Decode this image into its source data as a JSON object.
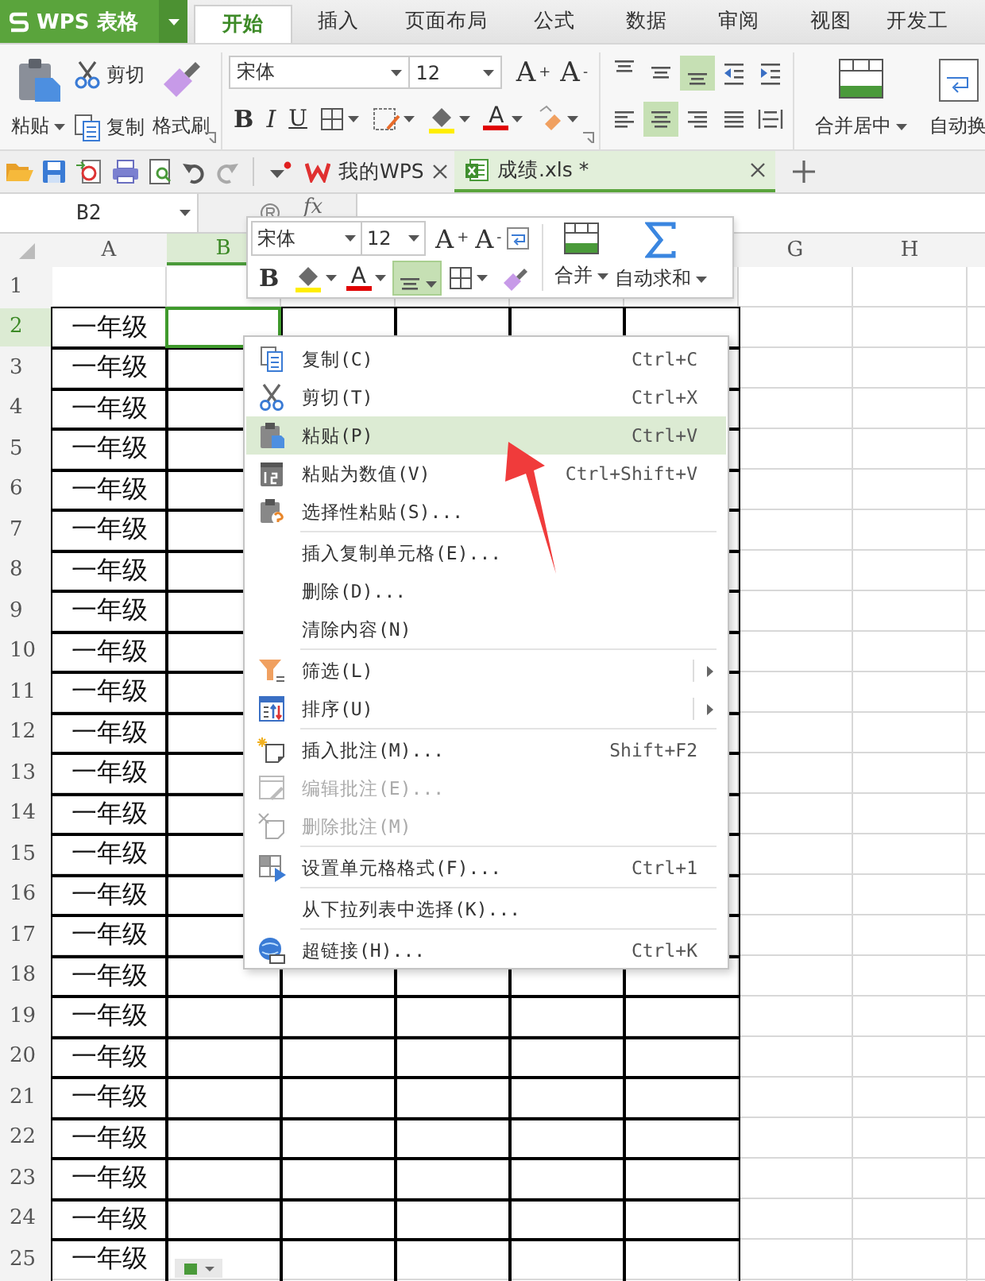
{
  "app_menu": {
    "label": "WPS 表格"
  },
  "ribbon_tabs": [
    {
      "label": "开始",
      "selected": true
    },
    {
      "label": "插入",
      "selected": false
    },
    {
      "label": "页面布局",
      "selected": false
    },
    {
      "label": "公式",
      "selected": false
    },
    {
      "label": "数据",
      "selected": false
    },
    {
      "label": "审阅",
      "selected": false
    },
    {
      "label": "视图",
      "selected": false
    },
    {
      "label": "开发工",
      "selected": false
    }
  ],
  "ribbon": {
    "clipboard": {
      "paste": "粘贴",
      "cut": "剪切",
      "copy": "复制",
      "format_painter": "格式刷"
    },
    "font": {
      "name": "宋体",
      "size": "12",
      "grow": "A$^{+}$",
      "shrink": "A$^{-}$",
      "bold": "B",
      "italic": "I",
      "underline": "U",
      "font_color": "A"
    },
    "alignment": [
      {
        "kind": "top",
        "selected": false
      },
      {
        "kind": "middle",
        "selected": false
      },
      {
        "kind": "bottom",
        "selected": true
      },
      {
        "kind": "outdent",
        "selected": false
      },
      {
        "kind": "indent",
        "selected": false
      },
      {
        "kind": "left",
        "selected": false
      },
      {
        "kind": "center",
        "selected": true
      },
      {
        "kind": "right",
        "selected": false
      },
      {
        "kind": "justify",
        "selected": false
      },
      {
        "kind": "distributed",
        "selected": false
      }
    ],
    "merge": {
      "label": "合并居中"
    },
    "wrap": {
      "label": "自动换"
    }
  },
  "doc_tabs": [
    {
      "kind": "home",
      "label": "我的WPS",
      "selected": false
    },
    {
      "kind": "sheet",
      "label": "成绩.xls *",
      "selected": true
    }
  ],
  "formula_bar": {
    "name_box": "B2",
    "fx": "fx"
  },
  "sheet": {
    "columns": [
      {
        "label": "A",
        "selected": false,
        "bordered": true
      },
      {
        "label": "B",
        "selected": true,
        "bordered": true
      },
      {
        "selected": false,
        "bordered": true
      },
      {
        "selected": false,
        "bordered": true
      },
      {
        "selected": false,
        "bordered": true
      },
      {
        "selected": false,
        "bordered": true
      },
      {
        "label": "G",
        "selected": false,
        "bordered": false
      },
      {
        "label": "H",
        "selected": false,
        "bordered": false
      }
    ],
    "rows": [
      {
        "number": "1",
        "selected": false,
        "bordered": false
      },
      {
        "number": "2",
        "selected": true,
        "bordered": true,
        "grade": "一年级"
      },
      {
        "number": "3",
        "selected": false,
        "bordered": true,
        "grade": "一年级"
      },
      {
        "number": "4",
        "selected": false,
        "bordered": true,
        "grade": "一年级"
      },
      {
        "number": "5",
        "selected": false,
        "bordered": true,
        "grade": "一年级"
      },
      {
        "number": "6",
        "selected": false,
        "bordered": true,
        "grade": "一年级"
      },
      {
        "number": "7",
        "selected": false,
        "bordered": true,
        "grade": "一年级"
      },
      {
        "number": "8",
        "selected": false,
        "bordered": true,
        "grade": "一年级"
      },
      {
        "number": "9",
        "selected": false,
        "bordered": true,
        "grade": "一年级"
      },
      {
        "number": "10",
        "selected": false,
        "bordered": true,
        "grade": "一年级"
      },
      {
        "number": "11",
        "selected": false,
        "bordered": true,
        "grade": "一年级"
      },
      {
        "number": "12",
        "selected": false,
        "bordered": true,
        "grade": "一年级"
      },
      {
        "number": "13",
        "selected": false,
        "bordered": true,
        "grade": "一年级"
      },
      {
        "number": "14",
        "selected": false,
        "bordered": true,
        "grade": "一年级"
      },
      {
        "number": "15",
        "selected": false,
        "bordered": true,
        "grade": "一年级"
      },
      {
        "number": "16",
        "selected": false,
        "bordered": true,
        "grade": "一年级"
      },
      {
        "number": "17",
        "selected": false,
        "bordered": true,
        "grade": "一年级"
      },
      {
        "number": "18",
        "selected": false,
        "bordered": true,
        "grade": "一年级"
      },
      {
        "number": "19",
        "selected": false,
        "bordered": true,
        "grade": "一年级"
      },
      {
        "number": "20",
        "selected": false,
        "bordered": true,
        "grade": "一年级"
      },
      {
        "number": "21",
        "selected": false,
        "bordered": true,
        "grade": "一年级"
      },
      {
        "number": "22",
        "selected": false,
        "bordered": true,
        "grade": "一年级"
      },
      {
        "number": "23",
        "selected": false,
        "bordered": true,
        "grade": "一年级"
      },
      {
        "number": "24",
        "selected": false,
        "bordered": true,
        "grade": "一年级"
      },
      {
        "number": "25",
        "selected": false,
        "bordered": true,
        "grade": "一年级"
      }
    ]
  },
  "mini_toolbar": {
    "font": "宋体",
    "size": "12",
    "grow": "A$^{+}$",
    "shrink": "A$^{-}$",
    "bold": "B",
    "font_color": "A",
    "align_selected": true,
    "merge": "合并",
    "autosum": "自动求和"
  },
  "context_menu": [
    {
      "kind": "copy",
      "label": "复制(C)",
      "shortcut": "Ctrl+C",
      "selected": false,
      "disabled": false,
      "submenu": false
    },
    {
      "kind": "cut",
      "label": "剪切(T)",
      "shortcut": "Ctrl+X",
      "selected": false,
      "disabled": false,
      "submenu": false
    },
    {
      "kind": "paste",
      "label": "粘贴(P)",
      "shortcut": "Ctrl+V",
      "selected": true,
      "disabled": false,
      "submenu": false
    },
    {
      "kind": "values",
      "label": "粘贴为数值(V)",
      "shortcut": "Ctrl+Shift+V",
      "selected": false,
      "disabled": false,
      "submenu": false
    },
    {
      "kind": "special",
      "label": "选择性粘贴(S)...",
      "selected": false,
      "disabled": false,
      "submenu": false
    },
    {
      "kind": "separator"
    },
    {
      "kind": "plain",
      "label": "插入复制单元格(E)...",
      "selected": false,
      "disabled": false,
      "submenu": false
    },
    {
      "kind": "plain",
      "label": "删除(D)...",
      "selected": false,
      "disabled": false,
      "submenu": false
    },
    {
      "kind": "plain",
      "label": "清除内容(N)",
      "selected": false,
      "disabled": false,
      "submenu": false
    },
    {
      "kind": "separator"
    },
    {
      "kind": "filter",
      "label": "筛选(L)",
      "selected": false,
      "disabled": false,
      "submenu": true
    },
    {
      "kind": "sort",
      "label": "排序(U)",
      "selected": false,
      "disabled": false,
      "submenu": true
    },
    {
      "kind": "separator"
    },
    {
      "kind": "comment",
      "label": "插入批注(M)...",
      "shortcut": "Shift+F2",
      "selected": false,
      "disabled": false,
      "submenu": false
    },
    {
      "kind": "edit",
      "label": "编辑批注(E)...",
      "selected": false,
      "disabled": true,
      "submenu": false
    },
    {
      "kind": "remove",
      "label": "删除批注(M)",
      "selected": false,
      "disabled": true,
      "submenu": false
    },
    {
      "kind": "separator"
    },
    {
      "kind": "format",
      "label": "设置单元格格式(F)...",
      "shortcut": "Ctrl+1",
      "selected": false,
      "disabled": false,
      "submenu": false
    },
    {
      "kind": "separator"
    },
    {
      "kind": "plain",
      "label": "从下拉列表中选择(K)...",
      "selected": false,
      "disabled": false,
      "submenu": false
    },
    {
      "kind": "separator"
    },
    {
      "kind": "link",
      "label": "超链接(H)...",
      "shortcut": "Ctrl+K",
      "selected": false,
      "disabled": false,
      "submenu": false
    }
  ]
}
